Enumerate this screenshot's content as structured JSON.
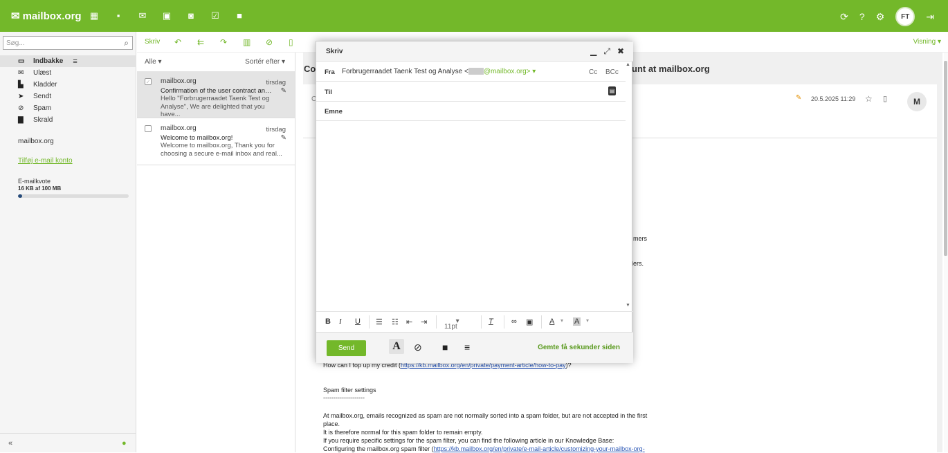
{
  "topbar": {
    "logo": "mailbox.org",
    "avatar": "FT"
  },
  "search": {
    "placeholder": "Søg..."
  },
  "folders": [
    {
      "label": "Indbakke",
      "icon": "inbox-icon"
    },
    {
      "label": "Ulæst",
      "icon": "envelope-icon"
    },
    {
      "label": "Kladder",
      "icon": "draft-icon"
    },
    {
      "label": "Sendt",
      "icon": "sent-icon"
    },
    {
      "label": "Spam",
      "icon": "spam-icon"
    },
    {
      "label": "Skrald",
      "icon": "trash-icon"
    }
  ],
  "sidebar": {
    "account": "mailbox.org",
    "add_account": "Tilføj e-mail konto",
    "quota_label": "E-mailkvote",
    "quota_value": "16 KB af 100 MB",
    "quota_fraction": 0.04
  },
  "toolbar": {
    "skriv": "Skriv",
    "visning": "Visning"
  },
  "list": {
    "filter": "Alle",
    "sort": "Sortér efter"
  },
  "mails": [
    {
      "from": "mailbox.org",
      "date": "tirsdag",
      "subject": "Confirmation of the user contract and ...",
      "preview": "Hello \"Forbrugerraadet Taenk Test og Analyse\", We are delighted that you have..."
    },
    {
      "from": "mailbox.org",
      "date": "tirsdag",
      "subject": "Welcome to mailbox.org!",
      "preview": "Welcome to mailbox.org, Thank you for choosing a secure e-mail inbox and real..."
    }
  ],
  "reader": {
    "title_pre": "Co",
    "title_post": "unt at mailbox.org",
    "date": "20.5.2025 11:29",
    "avatar": "M",
    "frag1": "mers",
    "frag2": "iders.",
    "line_topup_pre": "How can I top up my credit (",
    "line_topup_link": "https://kb.mailbox.org/en/private/payment-article/how-to-pay",
    "line_topup_post": ")?",
    "spam_title": "Spam filter settings",
    "spam_rule": "--------------------",
    "spam_l1": "At mailbox.org, emails recognized as spam are not normally sorted into a spam folder, but are not accepted in the first",
    "spam_l2": "place.",
    "spam_l3": "It is therefore normal for this spam folder to remain empty.",
    "spam_l4": "If you require specific settings for the spam filter, you can find the following article in our Knowledge Base:",
    "spam_l5_pre": "Configuring the mailbox.org spam filter (",
    "spam_l5_link": "https://kb.mailbox.org/en/private/e-mail-article/customizing-your-mailbox-org-"
  },
  "compose": {
    "title": "Skriv",
    "from_label": "Fra",
    "from_name": "Forbrugerraadet Taenk Test og Analyse <",
    "from_domain": "@mailbox.org>",
    "cc": "Cc",
    "bcc": "BCc",
    "to_label": "Til",
    "subject_label": "Emne",
    "font_size": "11pt",
    "send": "Send",
    "saved": "Gemte få sekunder siden"
  },
  "colors": {
    "accent": "#73b82a"
  }
}
